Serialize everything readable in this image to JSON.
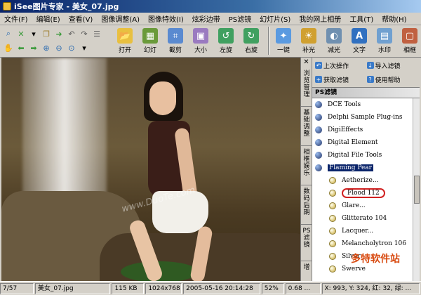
{
  "window": {
    "title": "iSee图片专家 - 美女_07.jpg"
  },
  "menu": [
    "文件(F)",
    "编辑(E)",
    "查看(V)",
    "图像调整(A)",
    "图像特效(I)",
    "炫彩边带",
    "PS滤镜",
    "幻灯片(S)",
    "我的网上相册",
    "工具(T)",
    "帮助(H)"
  ],
  "toolbar": {
    "big_tools": [
      {
        "label": "打开",
        "icon": "open-folder-icon",
        "color": "#e8c040"
      },
      {
        "label": "幻灯",
        "icon": "slideshow-icon",
        "color": "#6a9a3a"
      },
      {
        "label": "截剪",
        "icon": "crop-icon",
        "color": "#5a8ad0"
      },
      {
        "label": "大小",
        "icon": "resize-icon",
        "color": "#9a7ac0"
      },
      {
        "label": "左旋",
        "icon": "rotate-left-icon",
        "color": "#40a060"
      },
      {
        "label": "右旋",
        "icon": "rotate-right-icon",
        "color": "#40a060"
      },
      {
        "label": "一键",
        "icon": "one-click-icon",
        "color": "#5a9ae0"
      },
      {
        "label": "补光",
        "icon": "fill-light-icon",
        "color": "#d0a030"
      },
      {
        "label": "减光",
        "icon": "reduce-light-icon",
        "color": "#7090b0"
      },
      {
        "label": "文字",
        "icon": "text-icon",
        "color": "#3070c0"
      },
      {
        "label": "水印",
        "icon": "watermark-icon",
        "color": "#70a0d0"
      },
      {
        "label": "相框",
        "icon": "frame-icon",
        "color": "#c06040"
      }
    ]
  },
  "viewer": {
    "watermark": "www.DuoTe.com"
  },
  "side_tabs": [
    "浏览管理",
    "基础调整",
    "相框娱乐",
    "数码后期",
    "PS滤镜",
    "增"
  ],
  "panel": {
    "buttons": [
      "上次操作",
      "导入滤镜",
      "获取滤镜",
      "使用帮助"
    ],
    "header": "PS滤镜",
    "tree": [
      {
        "label": "DCE Tools",
        "type": "folder"
      },
      {
        "label": "Delphi Sample Plug-ins",
        "type": "folder"
      },
      {
        "label": "DigiEffects",
        "type": "folder"
      },
      {
        "label": "Digital Element",
        "type": "folder"
      },
      {
        "label": "Digital File Tools",
        "type": "folder"
      },
      {
        "label": "Flaming Pear",
        "type": "folder",
        "selected": true
      },
      {
        "label": "Aetherize...",
        "type": "child"
      },
      {
        "label": "Flood 112",
        "type": "child",
        "circled": true
      },
      {
        "label": "Glare...",
        "type": "child"
      },
      {
        "label": "Glitterato 104",
        "type": "child"
      },
      {
        "label": "Lacquer...",
        "type": "child"
      },
      {
        "label": "Melancholytron 106",
        "type": "child"
      },
      {
        "label": "Silver",
        "type": "child"
      },
      {
        "label": "Swerve",
        "type": "child"
      }
    ],
    "watermark": "多特软件站"
  },
  "status": {
    "page": "7/57",
    "filename": "美女_07.jpg",
    "filesize": "115 KB",
    "dimensions": "1024x768",
    "datetime": "2005-05-16 20:14:28",
    "zoom": "52%",
    "version": "0.68 ...",
    "coords": "X: 993, Y: 324, 红: 32, 绿: ..."
  }
}
